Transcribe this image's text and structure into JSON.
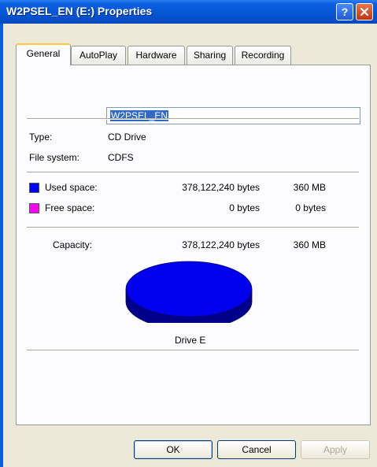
{
  "window": {
    "title": "W2PSEL_EN (E:) Properties",
    "help_label": "?",
    "accent": "#0555d4"
  },
  "tabs": [
    {
      "label": "General",
      "active": true
    },
    {
      "label": "AutoPlay"
    },
    {
      "label": "Hardware"
    },
    {
      "label": "Sharing"
    },
    {
      "label": "Recording"
    }
  ],
  "general": {
    "drive_name": "W2PSEL_EN",
    "type_label": "Type:",
    "type_value": "CD Drive",
    "fs_label": "File system:",
    "fs_value": "CDFS",
    "used": {
      "label": "Used space:",
      "bytes": "378,122,240 bytes",
      "size": "360 MB",
      "color": "#0000ff"
    },
    "free": {
      "label": "Free space:",
      "bytes": "0 bytes",
      "size": "0 bytes",
      "color": "#ff00ff"
    },
    "capacity": {
      "label": "Capacity:",
      "bytes": "378,122,240 bytes",
      "size": "360 MB"
    },
    "pie": {
      "used_fraction": 1.0,
      "top_color": "#0000ee",
      "side_color": "#00008b"
    },
    "drive_label": "Drive E"
  },
  "buttons": {
    "ok": "OK",
    "cancel": "Cancel",
    "apply": "Apply"
  }
}
